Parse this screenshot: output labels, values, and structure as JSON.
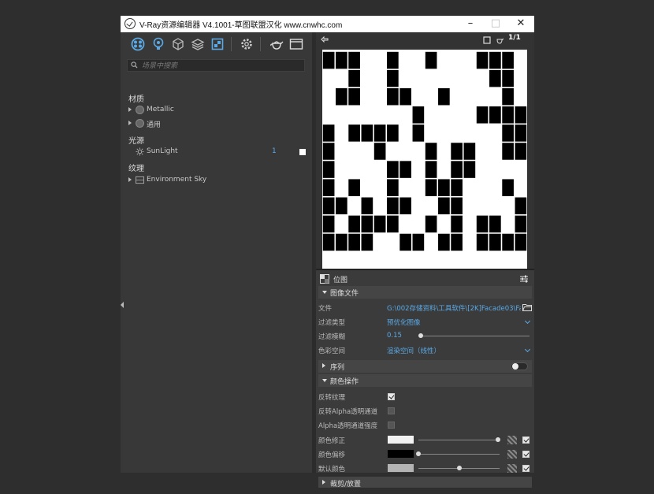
{
  "window": {
    "title": "V-Ray资源编辑器 V4.1001-草图联盟汉化 www.cnwhc.com",
    "controls": [
      "minimize",
      "maximize",
      "close"
    ]
  },
  "toolbar": {
    "icons": [
      "materials-icon",
      "lights-icon",
      "geometry-icon",
      "render-elements-icon",
      "textures-icon",
      "settings-icon",
      "render-teapot-icon",
      "render-window-icon"
    ]
  },
  "search": {
    "placeholder": "场景中搜索"
  },
  "outliner": {
    "materials_label": "材质",
    "materials": [
      "Metallic",
      "通用"
    ],
    "lights_label": "光源",
    "lights": [
      {
        "name": "SunLight",
        "count": "1"
      }
    ],
    "textures_label": "纹理",
    "textures": [
      "Environment Sky"
    ]
  },
  "preview": {
    "ratio": "1/1",
    "pattern": [
      "1110010010001110",
      "0010010000000110",
      "0110011001000010",
      "0000000100001111",
      "1011110100000011",
      "1000100010110011",
      "1000011010110000",
      "1010010011100010",
      "1101011001100001",
      "1011110010101101",
      "1111001101101111"
    ]
  },
  "props": {
    "header": "位图",
    "image_file_section": "图像文件",
    "file_label": "文件",
    "file_value": "G:\\002存储资料\\工具软件\\[2K]Facade03\\Fac...",
    "filter_type_label": "过滤类型",
    "filter_type_value": "预优化图像",
    "filter_blur_label": "过滤模糊",
    "filter_blur_value": "0.15",
    "filter_blur_fraction": 0.02,
    "color_space_label": "色彩空间",
    "color_space_value": "渲染空间（线性）",
    "sequence_section": "序列",
    "sequence_enabled": false,
    "color_ops_section": "颜色操作",
    "invert_texture_label": "反转纹理",
    "invert_texture_checked": true,
    "invert_alpha_label": "反转Alpha透明通道",
    "invert_alpha_checked": false,
    "alpha_strength_label": "Alpha透明通道强度",
    "alpha_strength_checked": false,
    "color_mult_label": "颜色修正",
    "color_mult_color": "#f2f2f2",
    "color_mult_fraction": 0.98,
    "color_offset_label": "颜色偏移",
    "color_offset_color": "#000000",
    "color_offset_fraction": 0.0,
    "default_color_label": "默认颜色",
    "default_color_color": "#b4b4b4",
    "default_color_fraction": 0.5,
    "crop_section": "裁剪/放置"
  },
  "colors": {
    "accent": "#5aa9e6",
    "panel": "#3a3a3a"
  }
}
